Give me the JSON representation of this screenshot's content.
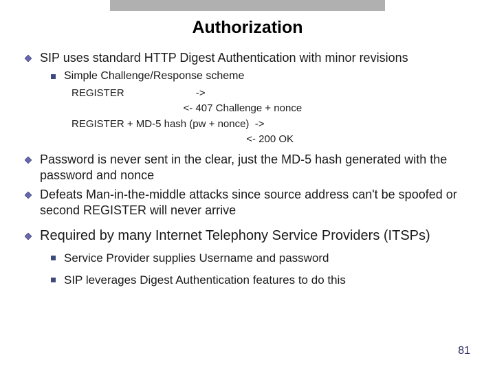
{
  "title": "Authorization",
  "bullets": {
    "b1": "SIP uses standard HTTP Digest Authentication with minor revisions",
    "b1_1": "Simple Challenge/Response scheme",
    "seq1": "REGISTER                         ->",
    "seq2": "                                       <- 407 Challenge + nonce",
    "seq3": "REGISTER + MD-5 hash (pw + nonce)  ->",
    "seq4": "                                                             <- 200 OK",
    "b2": "Password is never sent in the clear, just the MD-5 hash generated with the password and nonce",
    "b3": "Defeats Man-in-the-middle attacks since source address can't be spoofed or second REGISTER will never arrive",
    "b4": "Required by many Internet Telephony Service Providers (ITSPs)",
    "b4_1": "Service Provider supplies Username and password",
    "b4_2": "SIP leverages Digest Authentication features to do this"
  },
  "pagenum": "81",
  "colors": {
    "diamond": "#5a5aa8",
    "square": "#3d4a80"
  }
}
